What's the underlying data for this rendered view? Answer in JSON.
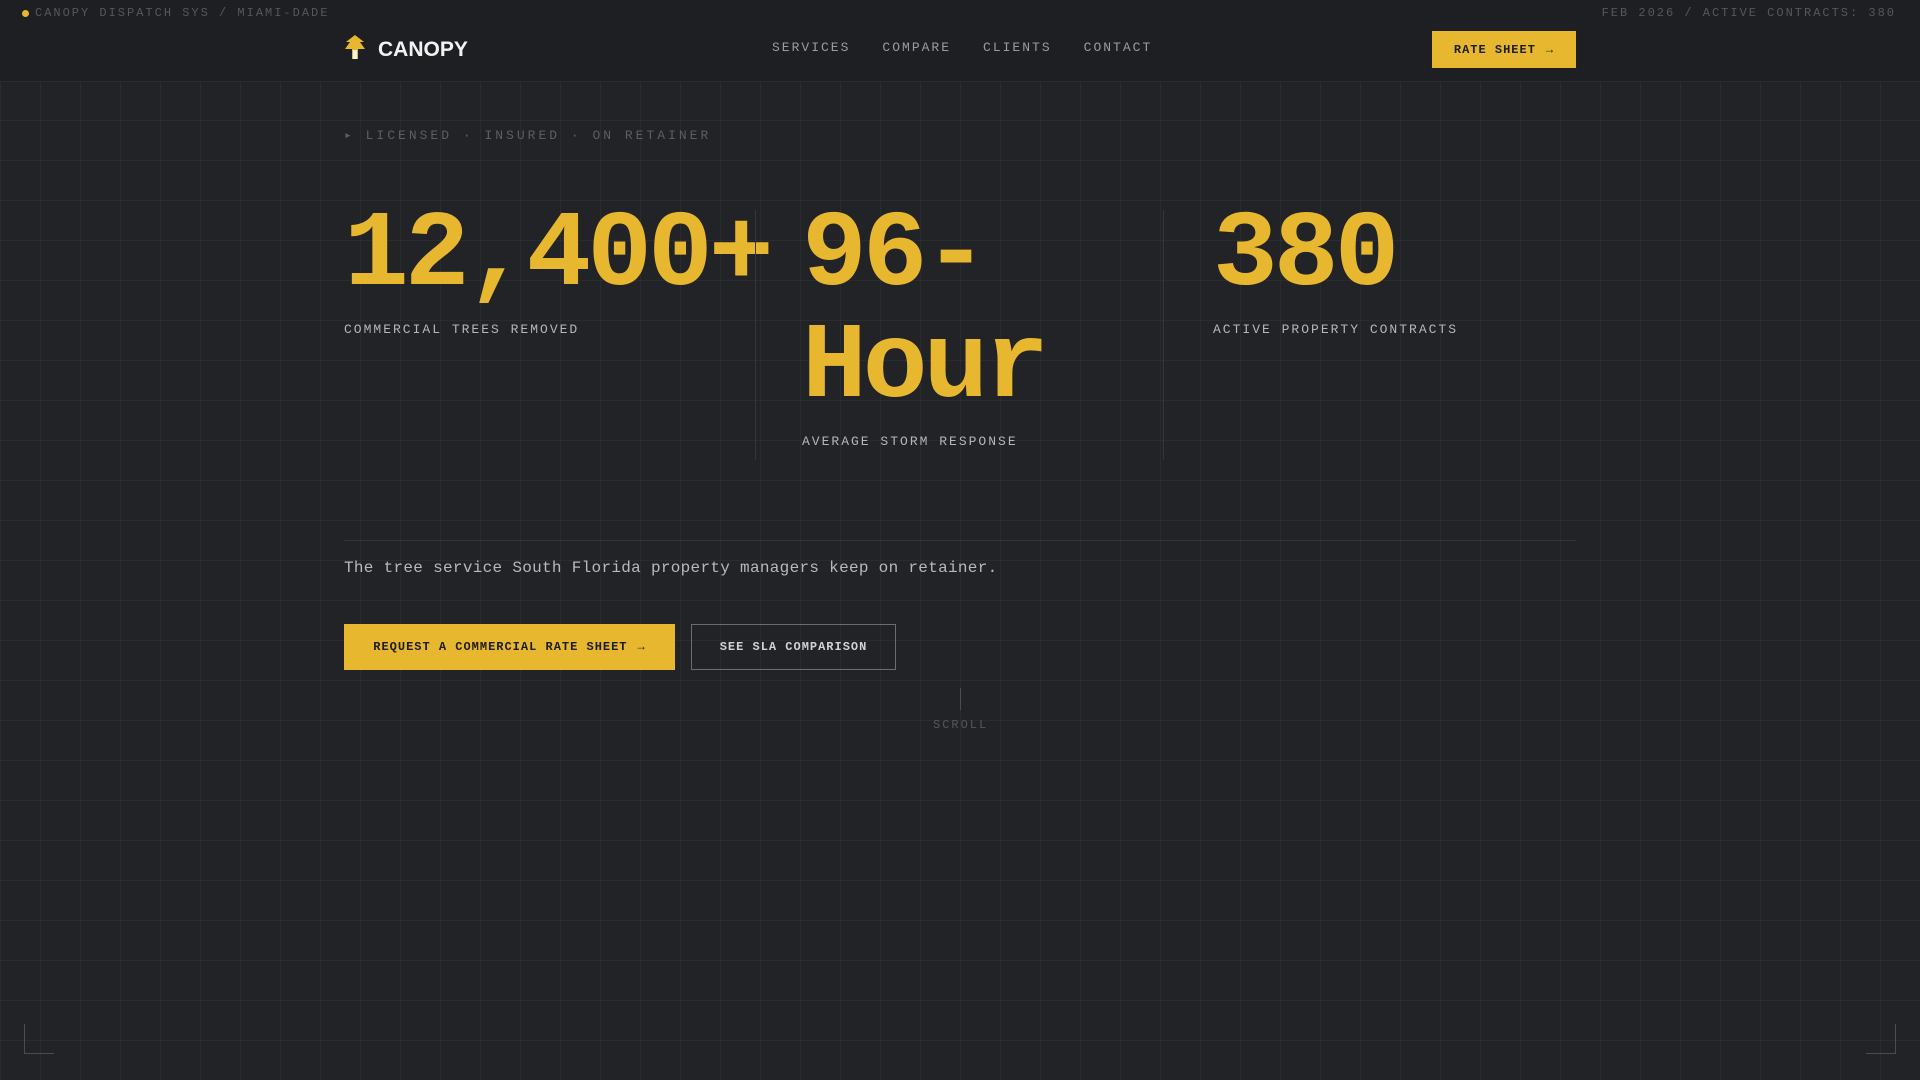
{
  "system": {
    "left_text": "CANOPY DISPATCH SYS / MIAMI-DADE",
    "right_text": "FEB 2026 / ACTIVE CONTRACTS: 380"
  },
  "brand": {
    "name": "CANOPY",
    "icon": "tree-emblem-icon"
  },
  "nav": {
    "items": [
      "SERVICES",
      "COMPARE",
      "CLIENTS",
      "CONTACT"
    ],
    "rate_button": "RATE SHEET"
  },
  "hero": {
    "tagline": "▸ LICENSED · INSURED · ON RETAINER",
    "stats": [
      {
        "value": "12,400+",
        "label": "COMMERCIAL TREES REMOVED"
      },
      {
        "value": "96-Hour",
        "value_line1": "96-",
        "value_line2": "Hour",
        "label": "AVERAGE STORM RESPONSE"
      },
      {
        "value": "380",
        "label": "ACTIVE PROPERTY CONTRACTS"
      }
    ],
    "description": "The tree service South Florida property managers keep on retainer.",
    "primary_cta": "REQUEST A COMMERCIAL RATE SHEET",
    "secondary_cta": "SEE SLA COMPARISON",
    "scroll_label": "SCROLL"
  },
  "colors": {
    "accent": "#e8b730",
    "background": "#222326",
    "topbar": "#1e1f22"
  }
}
